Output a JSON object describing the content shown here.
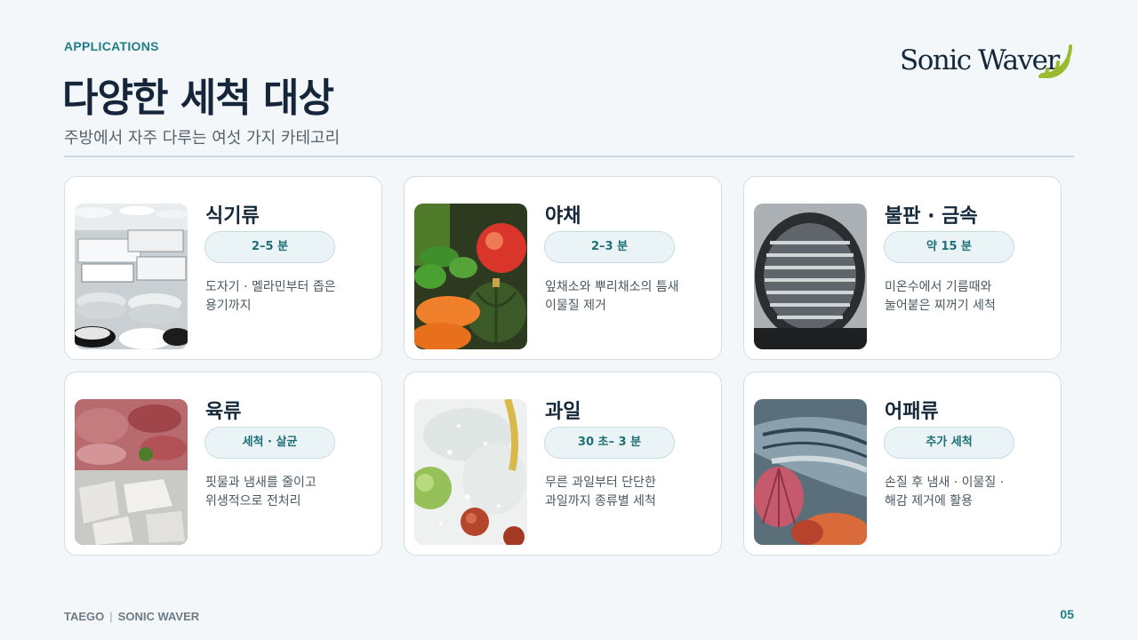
{
  "header": {
    "eyebrow": "APPLICATIONS",
    "title": "다양한 세척 대상",
    "subtitle": "주방에서 자주 다루는 여섯 가지 카테고리"
  },
  "logo": {
    "text": "Sonic Waver",
    "icon": "sound-wave-icon",
    "wave_color": "#9bbb2f"
  },
  "cards": [
    {
      "title": "식기류",
      "badge": "2–5 분",
      "desc": [
        "도자기 · 멜라민부터 좁은",
        "용기까지"
      ],
      "image": "dishes-photo"
    },
    {
      "title": "야채",
      "badge": "2–3 분",
      "desc": [
        "잎채소와 뿌리채소의 틈새",
        "이물질 제거"
      ],
      "image": "vegetables-photo"
    },
    {
      "title": "불판 · 금속",
      "badge": "약 15 분",
      "desc": [
        "미온수에서 기름때와",
        "눌어붙은 찌꺼기 세척"
      ],
      "image": "grill-pan-photo"
    },
    {
      "title": "육류",
      "badge": "세척 · 살균",
      "desc": [
        "핏물과 냄새를 줄이고",
        "위생적으로 전처리"
      ],
      "image": "meat-photo"
    },
    {
      "title": "과일",
      "badge": "30 초– 3 분",
      "desc": [
        "무른 과일부터 단단한",
        "과일까지 종류별 세척"
      ],
      "image": "fruit-photo"
    },
    {
      "title": "어패류",
      "badge": "추가 세척",
      "desc": [
        "손질 후 냄새 · 이물질 ·",
        "해감 제거에 활용"
      ],
      "image": "seafood-photo"
    }
  ],
  "footer": {
    "brand_left": "TAEGO",
    "brand_right": "SONIC WAVER",
    "page": "05"
  },
  "colors": {
    "accent": "#1f7d85",
    "title": "#16263a",
    "background": "#f3f7f9"
  }
}
